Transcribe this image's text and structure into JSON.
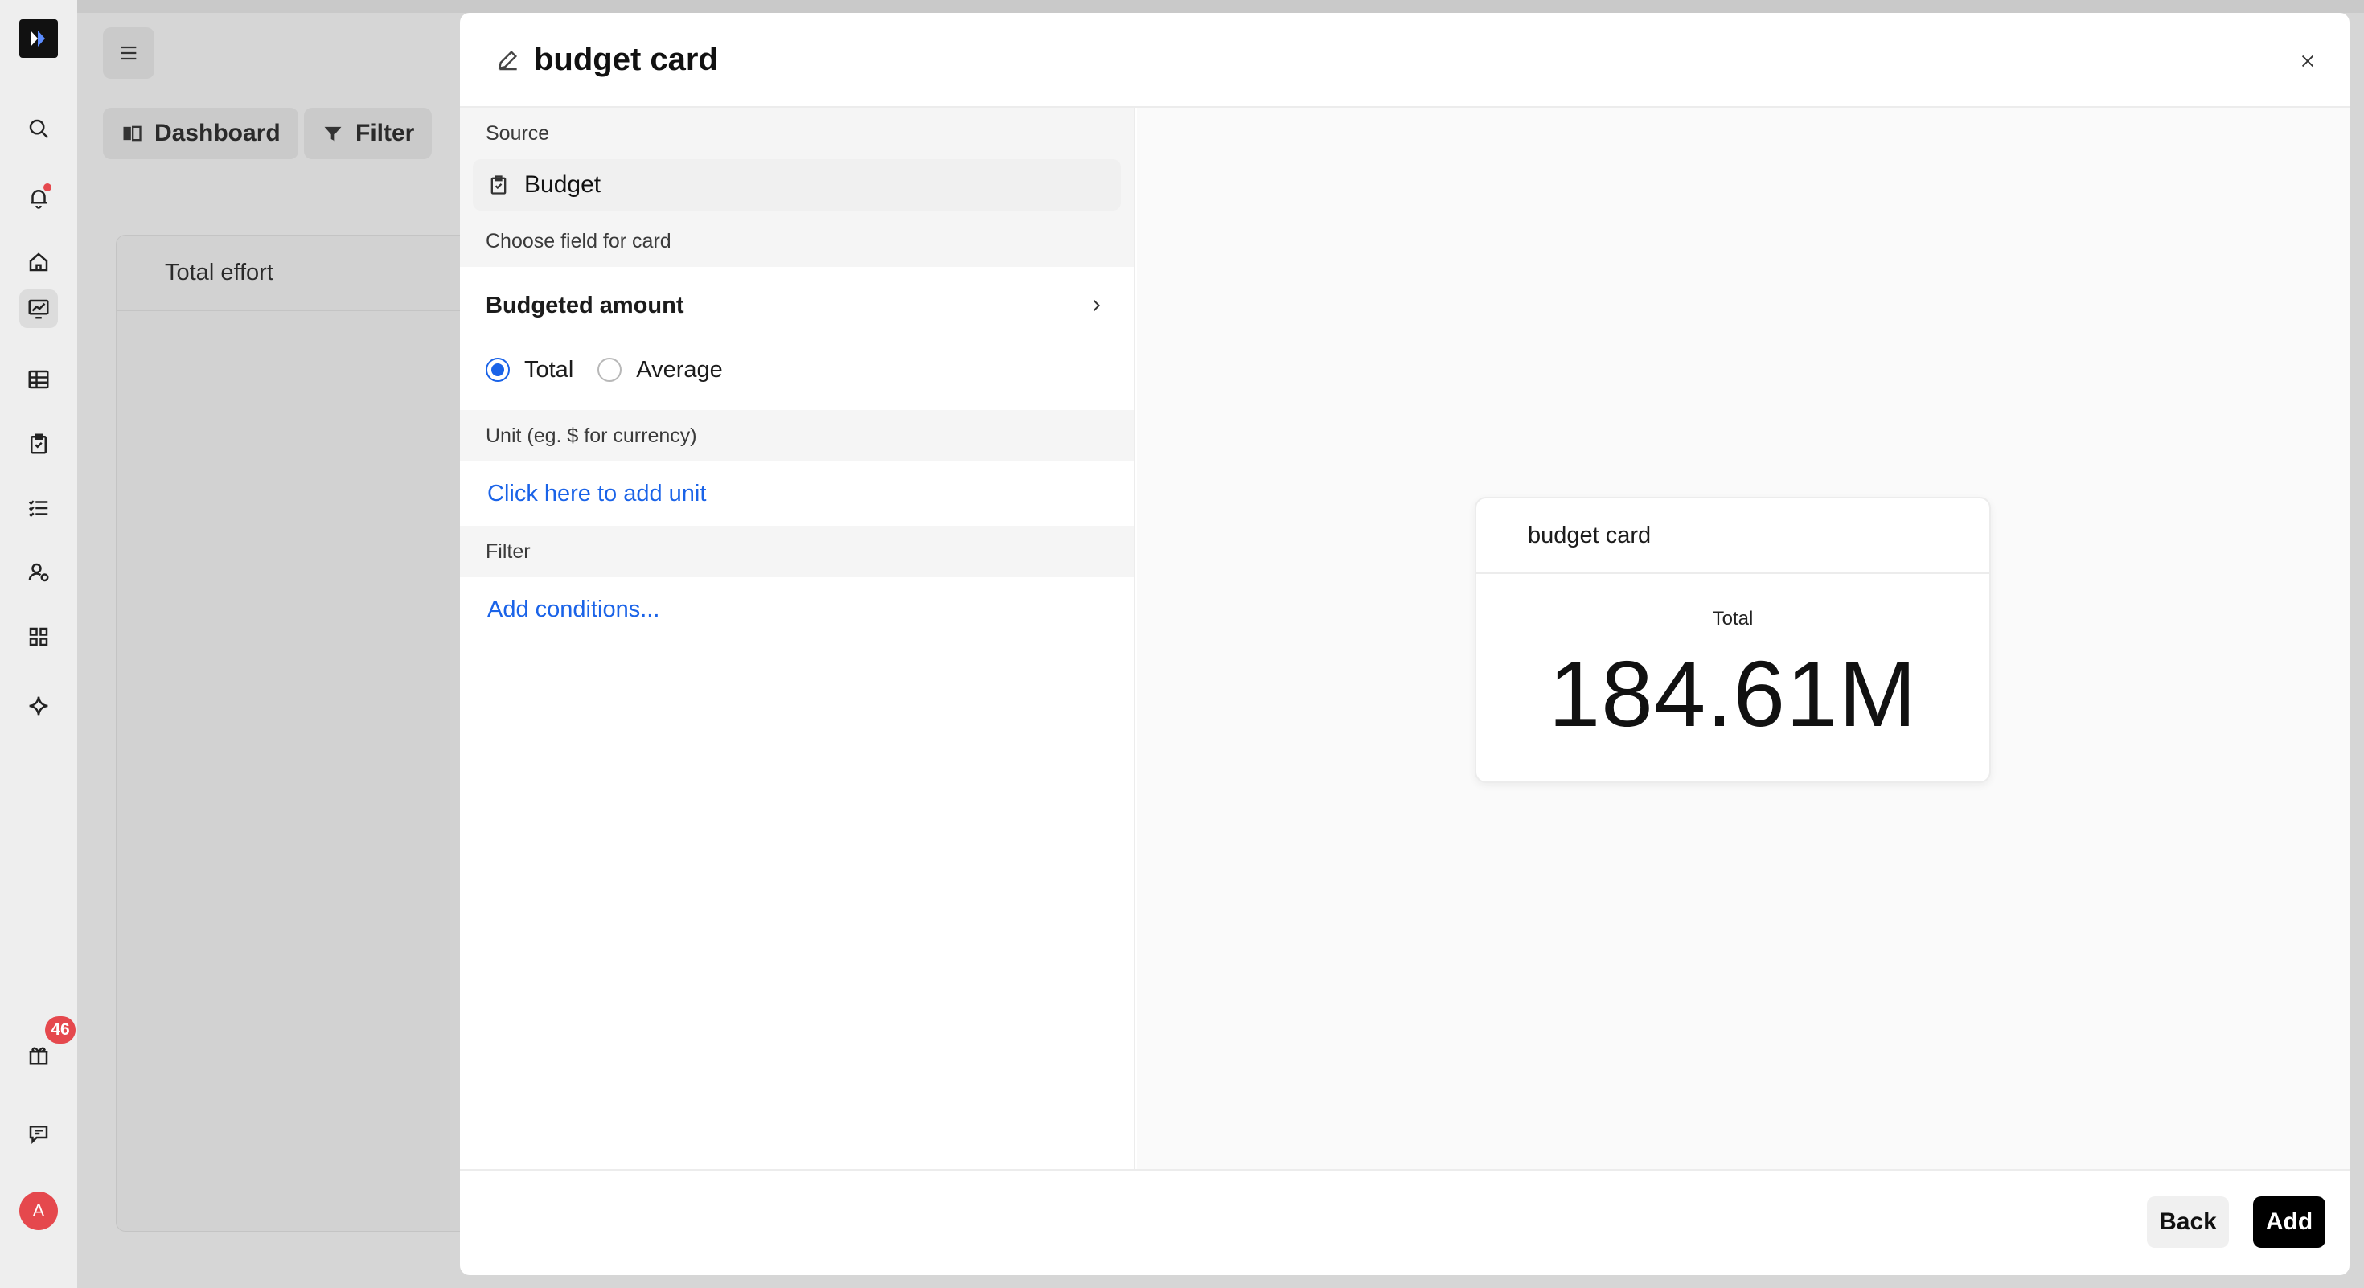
{
  "sidebar": {
    "icons": [
      "logo-icon",
      "search-icon",
      "bell-icon",
      "home-icon",
      "dashboard-icon",
      "table-icon",
      "clipboard-icon",
      "list-icon",
      "user-settings-icon",
      "apps-icon",
      "sparkle-icon",
      "gift-icon",
      "chat-icon"
    ],
    "gift_badge": "46",
    "avatar_initial": "A"
  },
  "background": {
    "dashboard_label": "Dashboard",
    "filter_label": "Filter",
    "card_title": "Total effort"
  },
  "modal": {
    "title": "budget card",
    "source_label": "Source",
    "source_value": "Budget",
    "field_label": "Choose field for card",
    "field_value": "Budgeted amount",
    "aggregation": {
      "options": [
        "Total",
        "Average"
      ],
      "selected": "Total"
    },
    "unit_label": "Unit (eg. $ for currency)",
    "unit_link": "Click here to add unit",
    "filter_label": "Filter",
    "filter_link": "Add conditions...",
    "preview": {
      "title": "budget card",
      "subtitle": "Total",
      "value": "184.61M"
    },
    "back_label": "Back",
    "add_label": "Add"
  },
  "colors": {
    "accent": "#1a63e8",
    "badge": "#e5484d",
    "primary_button": "#000000"
  }
}
